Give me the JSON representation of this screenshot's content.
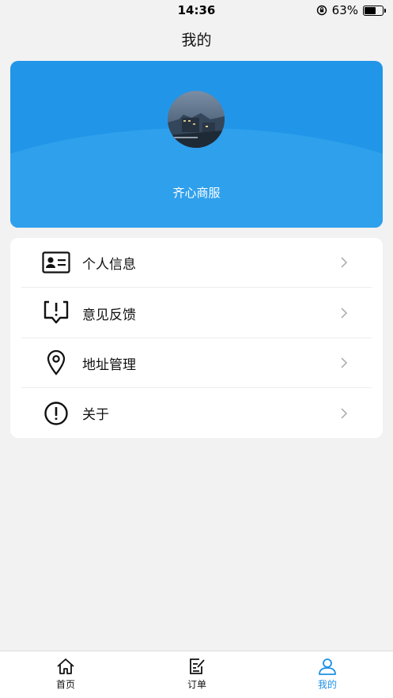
{
  "status_bar": {
    "time": "14:36",
    "battery_text": "63%",
    "battery_level": 0.63
  },
  "nav": {
    "title": "我的"
  },
  "profile": {
    "name": "齐心商服",
    "accent_color": "#2196e8"
  },
  "menu": [
    {
      "label": "个人信息",
      "icon": "id-card-icon"
    },
    {
      "label": "意见反馈",
      "icon": "feedback-icon"
    },
    {
      "label": "地址管理",
      "icon": "location-pin-icon"
    },
    {
      "label": "关于",
      "icon": "info-circle-icon"
    }
  ],
  "tab_bar": {
    "tabs": [
      {
        "label": "首页",
        "icon": "home-icon",
        "active": false
      },
      {
        "label": "订单",
        "icon": "order-icon",
        "active": false
      },
      {
        "label": "我的",
        "icon": "user-icon",
        "active": true
      }
    ],
    "active_color": "#1e90e6"
  }
}
